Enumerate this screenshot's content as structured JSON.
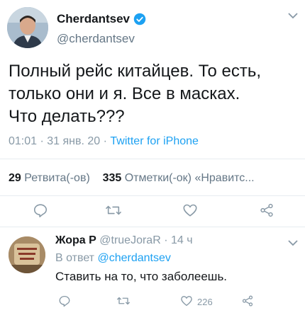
{
  "tweet": {
    "author_name": "Cherdantsev",
    "author_handle": "@cherdantsev",
    "text_lines": [
      "Полный рейс китайцев. То есть,",
      "только они и я. Все в масках.",
      "Что делать???"
    ],
    "time": "01:01 · 31 янв. 20 · ",
    "source": "Twitter for iPhone",
    "retweets_count": "29",
    "retweets_label": "Ретвита(-ов)",
    "likes_count": "335",
    "likes_label": "Отметки(-ок) «Нравитс..."
  },
  "reply": {
    "author_name": "Жора Р",
    "author_handle": "@trueJoraR · 14 ч",
    "in_reply_to_prefix": "В ответ ",
    "in_reply_to_handle": "@cherdantsev",
    "text": "Ставить на то, что заболеешь.",
    "likes_count": "226"
  },
  "icons": {
    "reply": "reply-icon",
    "retweet": "retweet-icon",
    "like": "heart-icon",
    "share": "share-icon",
    "verified": "verified-badge-icon",
    "menu": "chevron-down-icon"
  },
  "colors": {
    "accent": "#1da1f2",
    "muted": "#8899a6",
    "text": "#14171a",
    "divider": "#e6ecf0"
  }
}
